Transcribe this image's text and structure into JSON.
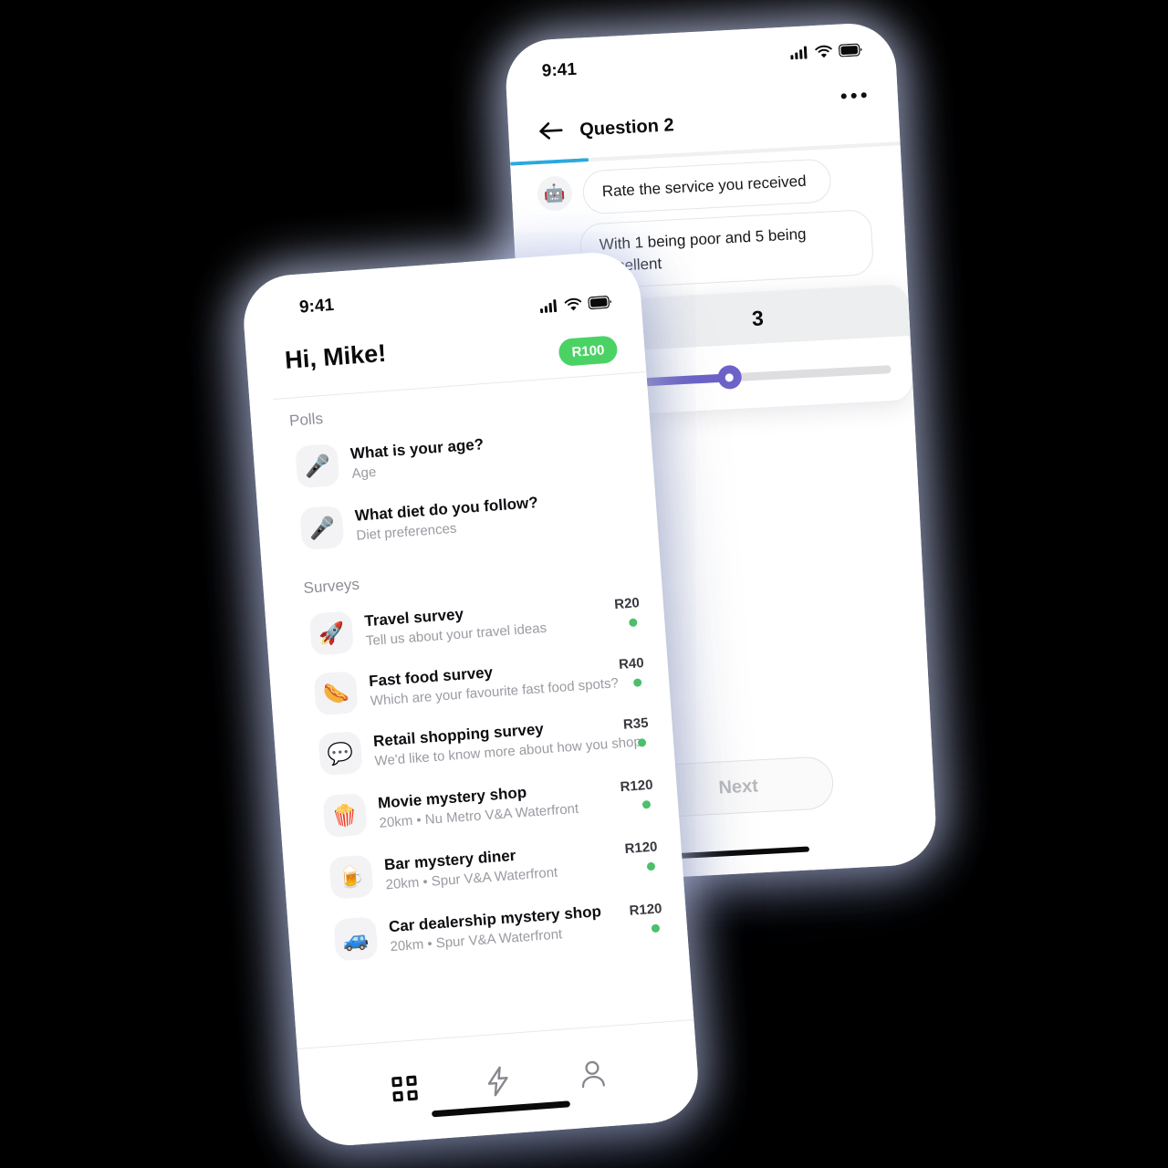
{
  "back_phone": {
    "status": {
      "time": "9:41",
      "signal_icon": "signal-bars-icon",
      "wifi_icon": "wifi-icon",
      "battery_icon": "battery-icon"
    },
    "nav": {
      "back_icon": "back-arrow-icon",
      "title": "Question 2",
      "more_icon": "more-options-icon"
    },
    "progress": {
      "percent": 20,
      "color": "#29a9e0"
    },
    "chat": {
      "avatar_emoji": "🤖",
      "bubbles": [
        {
          "text": "Rate the service you received"
        },
        {
          "text": "With 1 being poor and 5 being excellent"
        }
      ]
    },
    "slider": {
      "value": "3",
      "percent": 38,
      "fill_color": "#6c63c8",
      "knob_color": "#6c63c8",
      "track_color": "#dedee1"
    },
    "next_button": {
      "label": "Next"
    }
  },
  "front_phone": {
    "status": {
      "time": "9:41",
      "signal_icon": "signal-bars-icon",
      "wifi_icon": "wifi-icon",
      "battery_icon": "battery-icon"
    },
    "header": {
      "greeting": "Hi, Mike!",
      "balance": "R100",
      "balance_color": "#4bd264"
    },
    "sections": [
      {
        "label": "Polls"
      },
      {
        "label": "Surveys"
      }
    ],
    "polls": [
      {
        "icon": "🎤",
        "icon_name": "microphone-icon",
        "title": "What is your age?",
        "subtitle": "Age"
      },
      {
        "icon": "🎤",
        "icon_name": "microphone-icon",
        "title": "What diet do you follow?",
        "subtitle": "Diet preferences"
      }
    ],
    "surveys": [
      {
        "icon": "🚀",
        "icon_name": "rocket-icon",
        "title": "Travel survey",
        "subtitle": "Tell us about your travel ideas",
        "reward": "R20",
        "status_color": "#4cbf6a"
      },
      {
        "icon": "🌭",
        "icon_name": "hotdog-icon",
        "title": "Fast food survey",
        "subtitle": "Which are your favourite fast food spots?",
        "reward": "R40",
        "status_color": "#4cbf6a"
      },
      {
        "icon": "💬",
        "icon_name": "speech-balloon-icon",
        "title": "Retail shopping survey",
        "subtitle": "We'd like to know more about how you shop",
        "reward": "R35",
        "status_color": "#4cbf6a"
      },
      {
        "icon": "🍿",
        "icon_name": "popcorn-icon",
        "title": "Movie mystery shop",
        "subtitle": "20km • Nu Metro V&A Waterfront",
        "reward": "R120",
        "status_color": "#4cbf6a"
      },
      {
        "icon": "🍺",
        "icon_name": "beer-mug-icon",
        "title": "Bar mystery diner",
        "subtitle": "20km • Spur V&A Waterfront",
        "reward": "R120",
        "status_color": "#4cbf6a"
      },
      {
        "icon": "🚙",
        "icon_name": "car-icon",
        "title": "Car dealership mystery shop",
        "subtitle": "20km • Spur V&A Waterfront",
        "reward": "R120",
        "status_color": "#4cbf6a"
      }
    ],
    "tabs": [
      {
        "name": "grid-icon",
        "active": true
      },
      {
        "name": "lightning-bolt-icon",
        "active": false
      },
      {
        "name": "person-icon",
        "active": false
      }
    ]
  }
}
